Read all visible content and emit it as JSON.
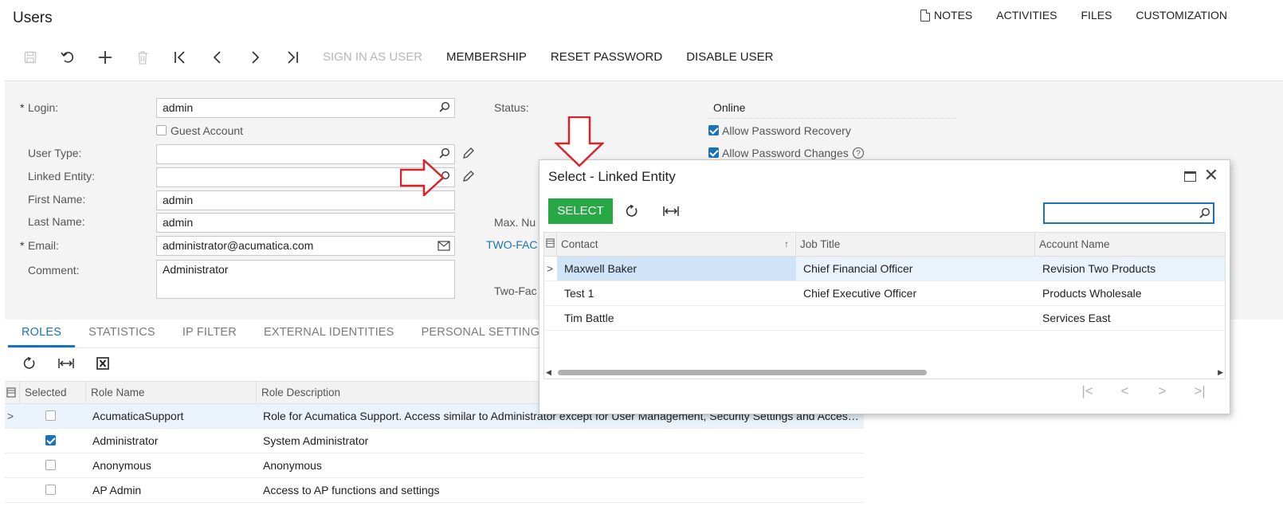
{
  "header": {
    "title": "Users",
    "links": [
      "NOTES",
      "ACTIVITIES",
      "FILES",
      "CUSTOMIZATION"
    ]
  },
  "toolbar": {
    "buttons": [
      "SIGN IN AS USER",
      "MEMBERSHIP",
      "RESET PASSWORD",
      "DISABLE USER"
    ]
  },
  "form": {
    "login_label": "Login:",
    "login_value": "admin",
    "guest_label": "Guest Account",
    "user_type_label": "User Type:",
    "user_type_value": "",
    "linked_entity_label": "Linked Entity:",
    "linked_entity_value": "",
    "first_name_label": "First Name:",
    "first_name_value": "admin",
    "last_name_label": "Last Name:",
    "last_name_value": "admin",
    "email_label": "Email:",
    "email_value": "administrator@acumatica.com",
    "comment_label": "Comment:",
    "comment_value": "Administrator",
    "status_label": "Status:",
    "status_value": "Online",
    "allow_recovery_label": "Allow Password Recovery",
    "allow_recovery_checked": true,
    "allow_changes_label": "Allow Password Changes",
    "allow_changes_checked": true,
    "max_num_label": "Max. Nu",
    "two_fa_link": "TWO-FAC",
    "two_fa_label": "Two-Fac"
  },
  "tabs": [
    "ROLES",
    "STATISTICS",
    "IP FILTER",
    "EXTERNAL IDENTITIES",
    "PERSONAL SETTINGS"
  ],
  "roles_grid": {
    "columns": [
      "Selected",
      "Role Name",
      "Role Description"
    ],
    "rows": [
      {
        "selected": false,
        "name": "AcumaticaSupport",
        "description": "Role for Acumatica Support. Access similar to Administrator except for User Management, Security Settings and Access..."
      },
      {
        "selected": true,
        "name": "Administrator",
        "description": "System Administrator"
      },
      {
        "selected": false,
        "name": "Anonymous",
        "description": "Anonymous"
      },
      {
        "selected": false,
        "name": "AP Admin",
        "description": "Access to AP functions and settings"
      }
    ]
  },
  "dialog": {
    "title": "Select - Linked Entity",
    "select_label": "SELECT",
    "search_value": "",
    "columns": [
      "Contact",
      "Job Title",
      "Account Name"
    ],
    "rows": [
      {
        "contact": "Maxwell Baker",
        "job_title": "Chief Financial Officer",
        "account": "Revision Two Products"
      },
      {
        "contact": "Test 1",
        "job_title": "Chief Executive Officer",
        "account": "Products Wholesale"
      },
      {
        "contact": "Tim Battle",
        "job_title": "",
        "account": "Services East"
      }
    ]
  },
  "colors": {
    "accent": "#1a73b8",
    "select_button": "#28a745",
    "annotation_arrow": "#d9232a"
  }
}
